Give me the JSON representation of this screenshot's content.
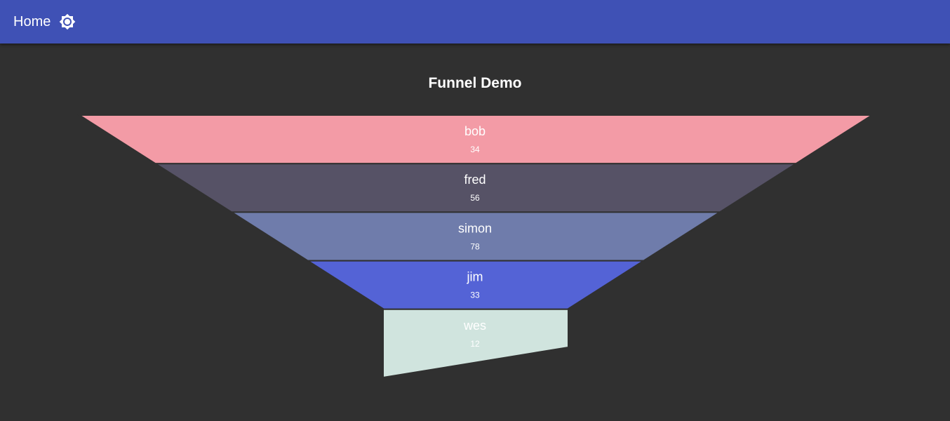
{
  "app_bar": {
    "home_label": "Home",
    "theme_icon": "brightness-icon",
    "background": "#3f51b5"
  },
  "chart_data": {
    "type": "funnel",
    "title": "Funnel Demo",
    "categories": [
      "bob",
      "fred",
      "simon",
      "jim",
      "wes"
    ],
    "values": [
      34,
      56,
      78,
      33,
      12
    ],
    "colors": [
      "#f39ba6",
      "#565266",
      "#6f7cab",
      "#5463d6",
      "#d0e4de"
    ],
    "legend": "none",
    "grid": false
  }
}
